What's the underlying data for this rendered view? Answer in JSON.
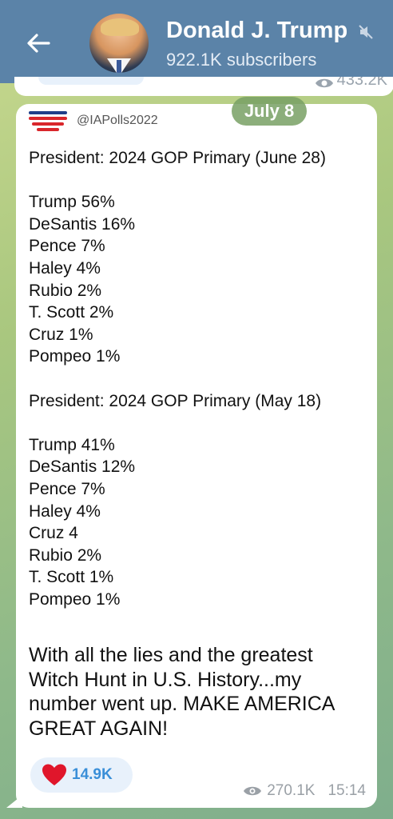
{
  "header": {
    "channel_name": "Donald J. Trump",
    "subscribers": "922.1K subscribers",
    "back_icon": "arrow-left-icon",
    "mute_icon": "muted-speaker-icon",
    "bg_color": "#5b83a8"
  },
  "previous_message": {
    "views": "433.2K"
  },
  "date_pill": "July 8",
  "message": {
    "handle": "@IAPolls2022",
    "poll1_title": "President: 2024 GOP Primary (June 28)",
    "poll1_results": [
      "Trump 56%",
      "DeSantis 16%",
      "Pence 7%",
      "Haley 4%",
      "Rubio 2%",
      "T. Scott 2%",
      "Cruz 1%",
      "Pompeo 1%"
    ],
    "poll2_title": "President: 2024 GOP Primary (May 18)",
    "poll2_results": [
      "Trump 41%",
      "DeSantis 12%",
      "Pence 7%",
      "Haley 4%",
      "Cruz 4",
      "Rubio 2%",
      "T. Scott 1%",
      "Pompeo 1%"
    ],
    "closing_lines": [
      "With all the lies and the greatest",
      "Witch Hunt in U.S. History...my",
      "number went up. MAKE AMERICA",
      "GREAT AGAIN!"
    ],
    "reaction_icon": "red-heart-icon",
    "reaction_count": "14.9K",
    "views": "270.1K",
    "time": "15:14"
  }
}
